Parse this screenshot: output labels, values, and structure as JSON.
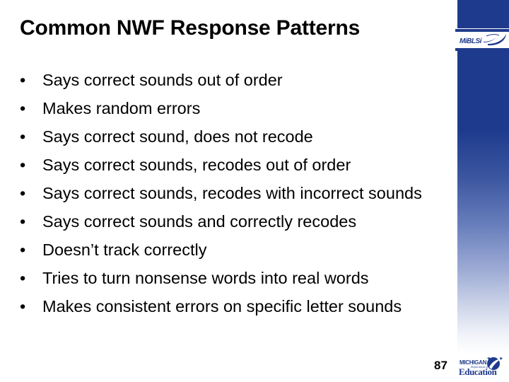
{
  "slide": {
    "title": "Common NWF Response Patterns",
    "page_number": "87",
    "background_color": "#ffffff",
    "accent_color": "#1e3a8c",
    "text_color": "#000000"
  },
  "bullets": [
    {
      "marker": "•",
      "text": "Says correct sounds out of order"
    },
    {
      "marker": "•",
      "text": "Makes random errors"
    },
    {
      "marker": "•",
      "text": "Says correct sound, does not recode"
    },
    {
      "marker": "•",
      "text": "Says correct sounds, recodes out of order"
    },
    {
      "marker": "•",
      "text": "Says correct sounds, recodes with incorrect sounds"
    },
    {
      "marker": "•",
      "text": "Says correct sounds and correctly recodes"
    },
    {
      "marker": "•",
      "text": "Doesn’t track correctly"
    },
    {
      "marker": "•",
      "text": "Tries to turn nonsense words into real words"
    },
    {
      "marker": "•",
      "text": "Makes consistent errors on specific letter sounds"
    }
  ],
  "branding": {
    "miblsi": {
      "wordmark": "MiBLSi",
      "icon": "swoosh-icon",
      "color": "#1e3a8c"
    },
    "mde": {
      "line1": "MICHIGAN",
      "line2": "Department of",
      "line3": "Education",
      "icon": "globe-swoosh-icon",
      "color": "#1e3a8c"
    }
  }
}
